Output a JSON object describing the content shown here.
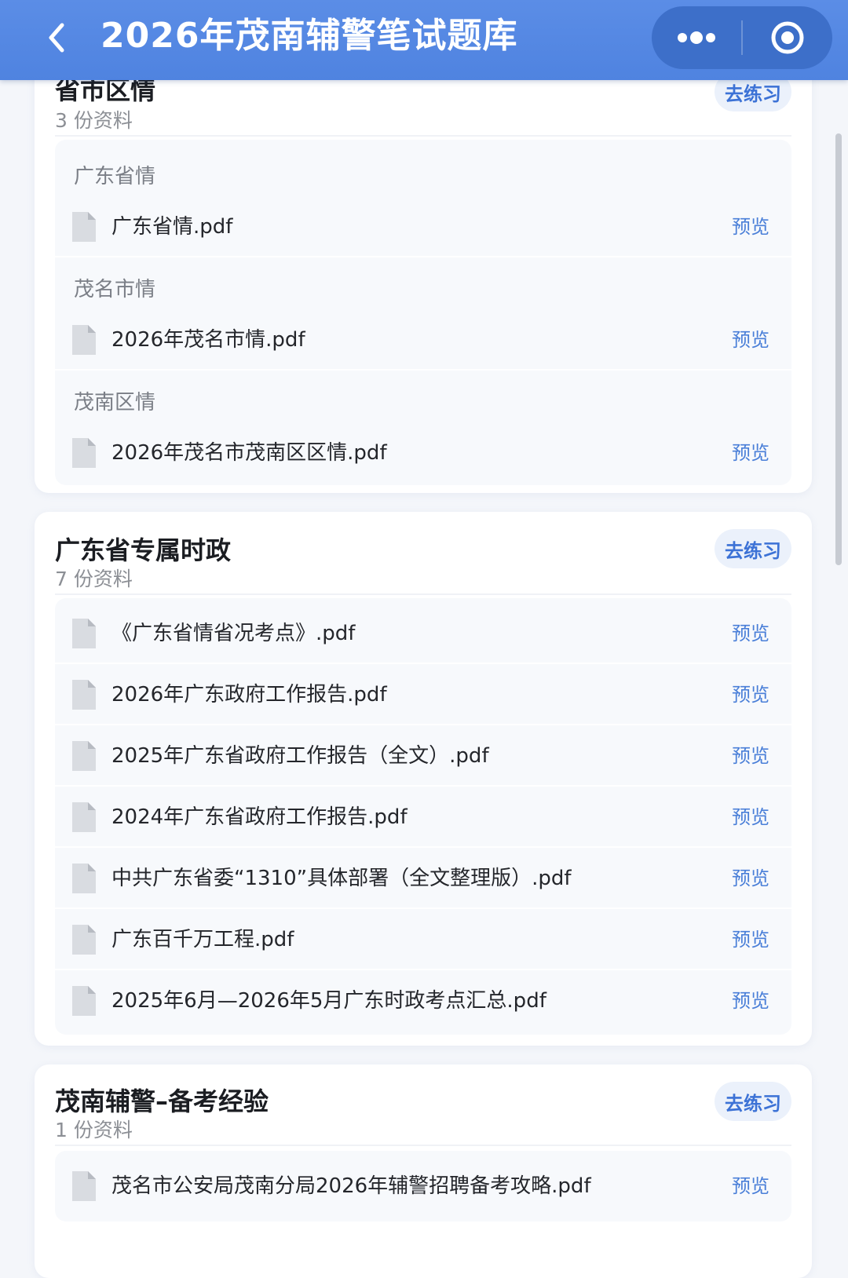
{
  "header": {
    "title": "2026年茂南辅警笔试题库",
    "back_icon": "chevron-left-icon",
    "more_icon": "more-dots-icon",
    "close_icon": "target-close-icon"
  },
  "colors": {
    "header_bg": "#5189e2",
    "accent": "#3c72d6",
    "practice_bg": "#ebf1fb"
  },
  "sections": [
    {
      "title": "省市区情",
      "count_text": "3 份资料",
      "practice_label": "去练习",
      "groups": [
        {
          "label": "广东省情",
          "files": [
            {
              "name": "广东省情.pdf",
              "action": "预览"
            }
          ]
        },
        {
          "label": "茂名市情",
          "files": [
            {
              "name": "2026年茂名市情.pdf",
              "action": "预览"
            }
          ]
        },
        {
          "label": "茂南区情",
          "files": [
            {
              "name": "2026年茂名市茂南区区情.pdf",
              "action": "预览"
            }
          ]
        }
      ]
    },
    {
      "title": "广东省专属时政",
      "count_text": "7 份资料",
      "practice_label": "去练习",
      "files": [
        {
          "name": "《广东省情省况考点》.pdf",
          "action": "预览"
        },
        {
          "name": "2026年广东政府工作报告.pdf",
          "action": "预览"
        },
        {
          "name": "2025年广东省政府工作报告（全文）.pdf",
          "action": "预览"
        },
        {
          "name": "2024年广东省政府工作报告.pdf",
          "action": "预览"
        },
        {
          "name": "中共广东省委“1310”具体部署（全文整理版）.pdf",
          "action": "预览"
        },
        {
          "name": "广东百千万工程.pdf",
          "action": "预览"
        },
        {
          "name": "2025年6月—2026年5月广东时政考点汇总.pdf",
          "action": "预览"
        }
      ]
    },
    {
      "title": "茂南辅警–备考经验",
      "count_text": "1 份资料",
      "practice_label": "去练习",
      "files": [
        {
          "name": "茂名市公安局茂南分局2026年辅警招聘备考攻略.pdf",
          "action": "预览"
        }
      ]
    }
  ]
}
